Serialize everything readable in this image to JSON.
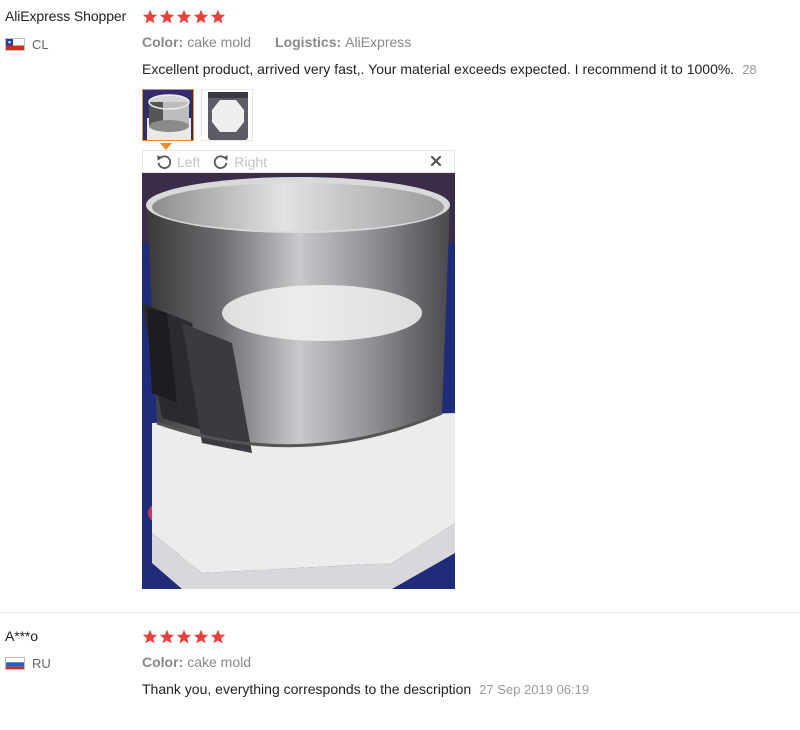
{
  "reviews": [
    {
      "user": "AliExpress Shopper",
      "country": "CL",
      "stars": 5,
      "color_label": "Color:",
      "color_value": "cake mold",
      "logistics_label": "Logistics:",
      "logistics_value": "AliExpress",
      "text": "Excellent product, arrived very fast,. Your material exceeds expected. I recommend it to 1000%.",
      "date": "28"
    },
    {
      "user": "A***o",
      "country": "RU",
      "stars": 5,
      "color_label": "Color:",
      "color_value": "cake mold",
      "text": "Thank you, everything corresponds to the description",
      "date": "27 Sep 2019 06:19"
    }
  ],
  "viewer": {
    "rotate_left": "Left",
    "rotate_right": "Right",
    "close_icon": "close-icon"
  },
  "colors": {
    "star": "#e8413c",
    "active_thumb": "#f08a24"
  }
}
